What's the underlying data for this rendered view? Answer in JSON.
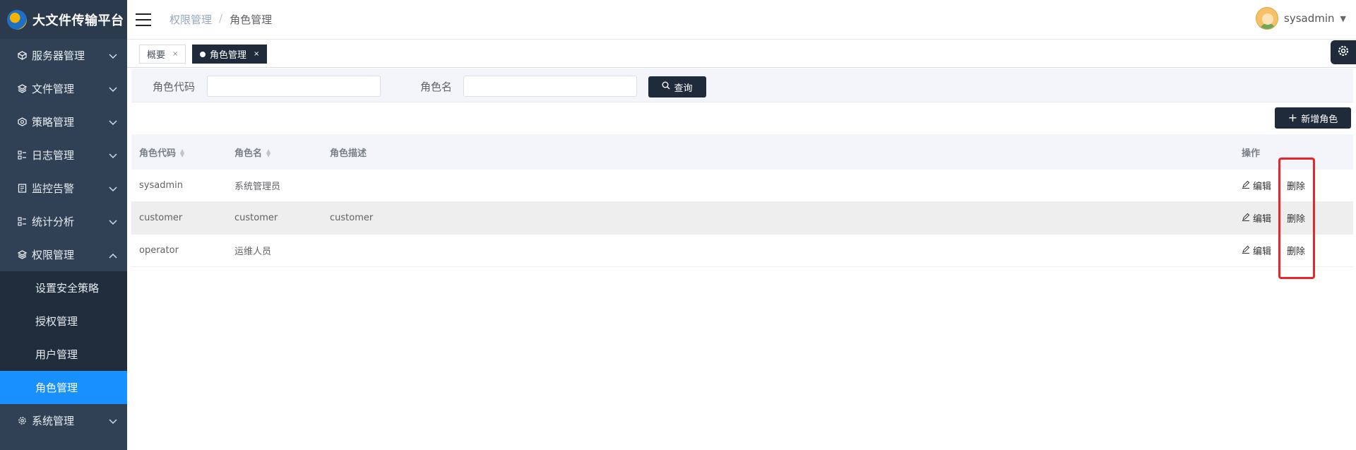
{
  "app": {
    "title": "大文件传输平台"
  },
  "sidebar": {
    "items": [
      {
        "label": "服务器管理",
        "icon": "server-icon"
      },
      {
        "label": "文件管理",
        "icon": "layers-icon"
      },
      {
        "label": "策略管理",
        "icon": "strategy-icon"
      },
      {
        "label": "日志管理",
        "icon": "log-icon"
      },
      {
        "label": "监控告警",
        "icon": "monitor-icon"
      },
      {
        "label": "统计分析",
        "icon": "chart-icon"
      },
      {
        "label": "权限管理",
        "icon": "layers-icon"
      },
      {
        "label": "系统管理",
        "icon": "gear-icon"
      }
    ],
    "sub_items": [
      {
        "label": "设置安全策略"
      },
      {
        "label": "授权管理"
      },
      {
        "label": "用户管理"
      },
      {
        "label": "角色管理",
        "active": true
      }
    ]
  },
  "header": {
    "breadcrumb": [
      "权限管理",
      "/",
      "角色管理"
    ],
    "user": "sysadmin"
  },
  "tabs": [
    {
      "label": "概要",
      "close": "×"
    },
    {
      "label": "角色管理",
      "close": "×",
      "active": true
    }
  ],
  "search": {
    "role_code_label": "角色代码",
    "role_code_value": "",
    "role_name_label": "角色名",
    "role_name_value": "",
    "query_button": "查询"
  },
  "toolbar": {
    "add_button": "新增角色"
  },
  "table": {
    "columns": [
      "角色代码",
      "角色名",
      "角色描述",
      "操作"
    ],
    "rows": [
      {
        "code": "sysadmin",
        "name": "系统管理员",
        "desc": "",
        "edit": "编辑",
        "delete": "删除"
      },
      {
        "code": "customer",
        "name": "customer",
        "desc": "customer",
        "edit": "编辑",
        "delete": "删除"
      },
      {
        "code": "operator",
        "name": "运维人员",
        "desc": "",
        "edit": "编辑",
        "delete": "删除"
      }
    ]
  },
  "colors": {
    "sidebar": "#304156",
    "accent": "#1890ff",
    "dark_button": "#1f2b3a",
    "highlight": "#e8262a"
  }
}
